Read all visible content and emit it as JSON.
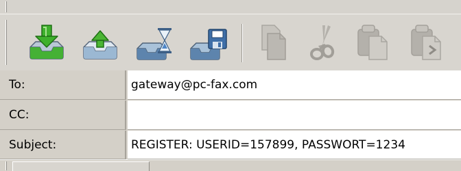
{
  "toolbar": {
    "buttons": [
      {
        "icon": "inbox-download-icon",
        "enabled": true
      },
      {
        "icon": "inbox-upload-icon",
        "enabled": true
      },
      {
        "icon": "inbox-pending-hourglass-icon",
        "enabled": true
      },
      {
        "icon": "inbox-save-icon",
        "enabled": true
      },
      {
        "icon": "copy-icon",
        "enabled": false
      },
      {
        "icon": "cut-scissors-icon",
        "enabled": false
      },
      {
        "icon": "paste-icon",
        "enabled": false
      },
      {
        "icon": "paste-special-icon",
        "enabled": false
      }
    ]
  },
  "form": {
    "to": {
      "label": "To:",
      "value": "gateway@pc-fax.com"
    },
    "cc": {
      "label": "CC:",
      "value": ""
    },
    "subject": {
      "label": "Subject:",
      "value": "REGISTER: USERID=157899, PASSWORT=1234"
    }
  },
  "colors": {
    "chrome": "#d4d0c8",
    "green_arrow": "#3fae2a",
    "tray_blue": "#8fb3d4",
    "disabled_gray": "#a9a7a2",
    "field_bg": "#ffffff"
  }
}
